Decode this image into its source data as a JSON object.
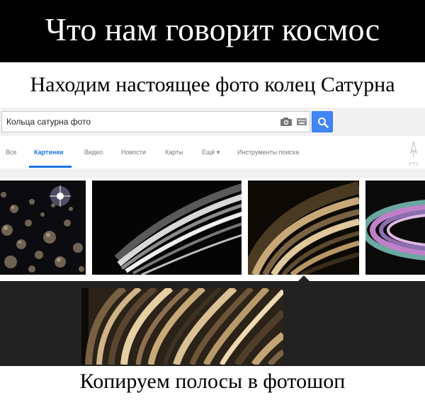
{
  "header": {
    "title": "Что нам говорит космос"
  },
  "subtitle": "Находим настоящее фото колец Сатурна",
  "search": {
    "value": "Кольца сатурна фото"
  },
  "tabs": [
    {
      "label": "Все"
    },
    {
      "label": "Картинки"
    },
    {
      "label": "Видео"
    },
    {
      "label": "Новости"
    },
    {
      "label": "Карты"
    },
    {
      "label": "Ещё ▾"
    },
    {
      "label": "Инструменты поиска"
    }
  ],
  "watermark": "PTY",
  "caption": "Копируем полосы в фотошоп",
  "colors": {
    "accent": "#4285f4",
    "active_tab": "#1a73e8"
  },
  "icons": [
    "camera-icon",
    "keyboard-icon",
    "search-icon"
  ]
}
